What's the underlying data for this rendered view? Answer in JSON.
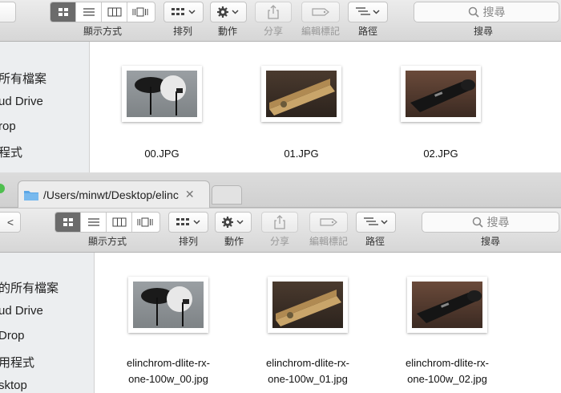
{
  "toolbar_labels": {
    "view": "顯示方式",
    "arrange": "排列",
    "action": "動作",
    "share": "分享",
    "edit_tags": "編輯標記",
    "path": "路徑",
    "search_label": "搜尋",
    "search_placeholder": "搜尋"
  },
  "window1": {
    "sidebar": [
      "所有檔案",
      "ud Drive",
      "rop",
      "程式"
    ],
    "files": [
      {
        "name": "00.JPG",
        "photo": "umbrella"
      },
      {
        "name": "01.JPG",
        "photo": "box"
      },
      {
        "name": "02.JPG",
        "photo": "bag"
      }
    ]
  },
  "window2": {
    "tab_path": "/Users/minwt/Desktop/elinc",
    "sidebar": [
      "的所有檔案",
      "ud Drive",
      "Drop",
      "用程式",
      "sktop"
    ],
    "files": [
      {
        "name_line1": "elinchrom-dlite-rx-",
        "name_line2": "one-100w_00.jpg",
        "photo": "umbrella"
      },
      {
        "name_line1": "elinchrom-dlite-rx-",
        "name_line2": "one-100w_01.jpg",
        "photo": "box"
      },
      {
        "name_line1": "elinchrom-dlite-rx-",
        "name_line2": "one-100w_02.jpg",
        "photo": "bag"
      }
    ]
  },
  "colors": {
    "selected_segment": "#6b6b6b",
    "folder": "#5aa6e6"
  }
}
